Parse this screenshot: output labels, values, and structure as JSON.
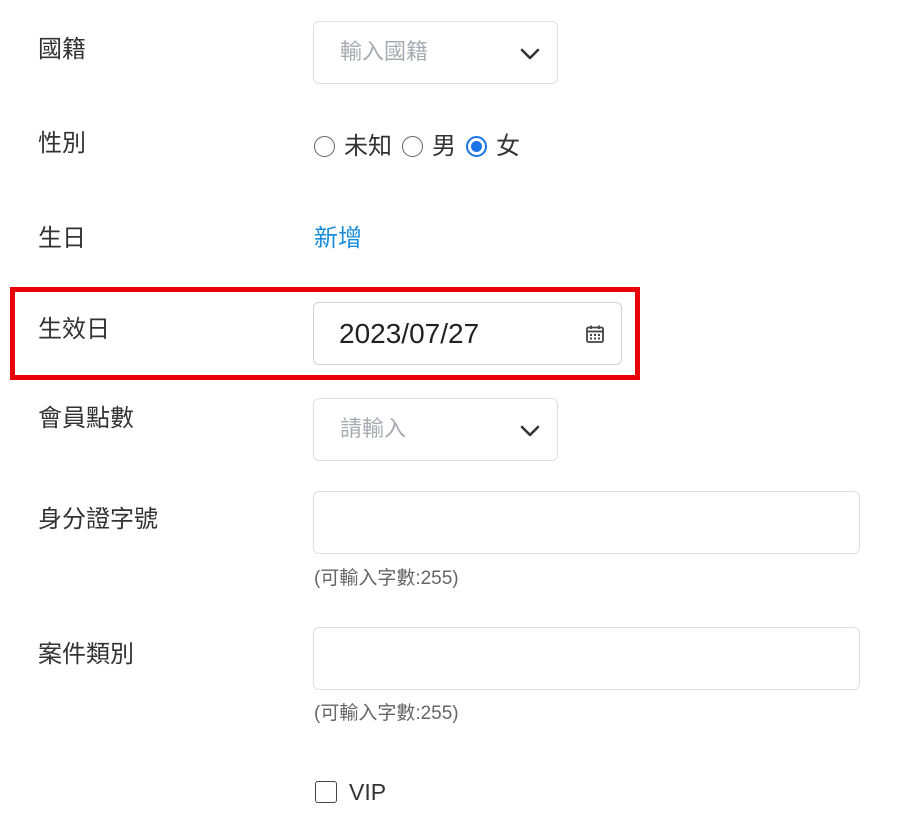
{
  "form": {
    "nationality": {
      "label": "國籍",
      "placeholder": "輸入國籍",
      "icon": "chevron-down-icon"
    },
    "gender": {
      "label": "性別",
      "options": [
        "未知",
        "男",
        "女"
      ],
      "selected": "女"
    },
    "birthday": {
      "label": "生日",
      "add_link": "新增"
    },
    "effective_date": {
      "label": "生效日",
      "value": "2023/07/27",
      "icon": "calendar-icon"
    },
    "member_points": {
      "label": "會員點數",
      "placeholder": "請輸入",
      "icon": "chevron-down-icon"
    },
    "id_number": {
      "label": "身分證字號",
      "value": "",
      "hint": "(可輸入字數:255)"
    },
    "case_category": {
      "label": "案件類別",
      "value": "",
      "hint": "(可輸入字數:255)"
    },
    "vip": {
      "label": "VIP",
      "checked": false
    }
  },
  "colors": {
    "highlight": "#e8000b",
    "link": "#1a8cdb",
    "radio_checked": "#1a73e8"
  }
}
